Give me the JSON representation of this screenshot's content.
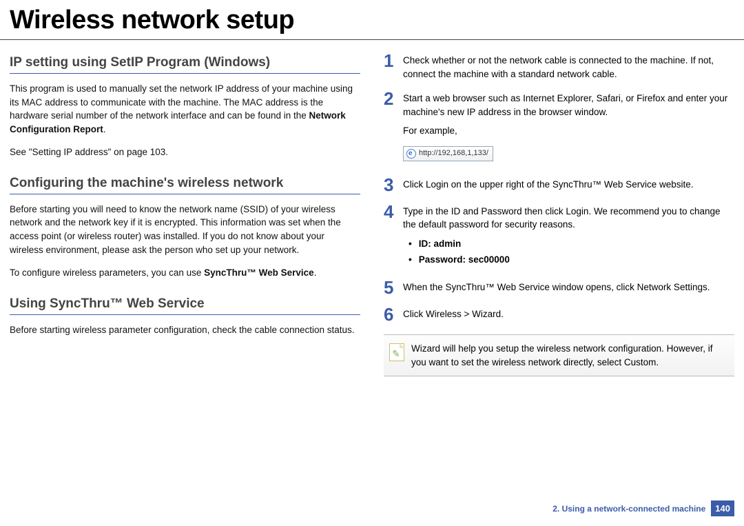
{
  "title": "Wireless network setup",
  "left": {
    "h1": "IP setting using SetIP Program (Windows)",
    "p1a": "This program is used to manually set the network IP address of your machine using its MAC address to communicate with the machine. The MAC address is the hardware serial number of the network interface and can be found in the ",
    "p1b": "Network Configuration Report",
    "p1c": ".",
    "p2": "See \"Setting IP address\" on page 103.",
    "h2": "Configuring the machine's wireless network",
    "p3": "Before starting you will need to know the network name (SSID) of your wireless network and the network key if it is encrypted. This information was set when the access point (or wireless router) was installed. If you do not know about your wireless environment, please ask the person who set up your network.",
    "p4a": "To configure wireless parameters, you can use ",
    "p4b": "SyncThru™ Web Service",
    "p4c": ".",
    "h3": "Using SyncThru™ Web Service",
    "p5": "Before starting wireless parameter configuration, check the cable connection status."
  },
  "right": {
    "steps": [
      {
        "n": "1",
        "html": "Check whether or not the network cable is connected to the machine. If not, connect the machine with a standard network cable."
      },
      {
        "n": "2",
        "html": "Start a web browser such as Internet Explorer, Safari, or Firefox and enter your machine's new IP address in the browser window.",
        "extra": "For example,",
        "url": "http://192,168,1,133/"
      },
      {
        "n": "3",
        "pre": "Click ",
        "b1": "Login",
        "post": " on the upper right of the SyncThru™ Web Service website."
      },
      {
        "n": "4",
        "pre": "Type in the ",
        "b1": "ID",
        "mid1": " and ",
        "b2": "Password",
        "mid2": " then click ",
        "b3": "Login",
        "post": ". We recommend you to change the default password for security reasons.",
        "bullets": [
          "ID: admin",
          "Password: sec00000"
        ]
      },
      {
        "n": "5",
        "pre": "When the ",
        "b1": "SyncThru™ Web Service",
        "mid1": " window opens, click ",
        "b2": "Network Settings",
        "post": "."
      },
      {
        "n": "6",
        "pre": "Click ",
        "b1": "Wireless",
        "mid1": " > ",
        "b2": "Wizard",
        "post": "."
      }
    ],
    "note": {
      "b1": "Wizard",
      "t1": " will help you setup the wireless network configuration. However, if you want to set the wireless network directly, select ",
      "b2": "Custom",
      "t2": "."
    }
  },
  "footer": {
    "chapter": "2.  Using a network-connected machine",
    "page": "140"
  }
}
